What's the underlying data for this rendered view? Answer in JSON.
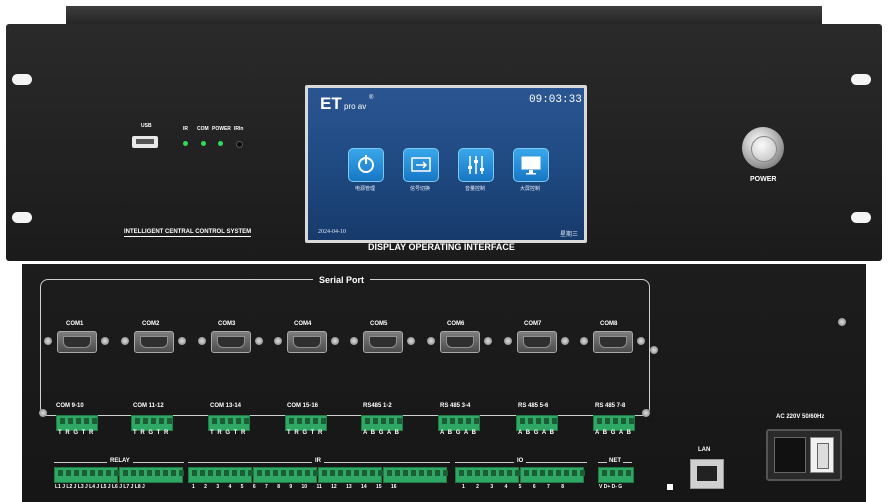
{
  "front": {
    "usb_label": "USB",
    "leds": [
      {
        "label": "IR",
        "color": "#2fdc5a"
      },
      {
        "label": "COM",
        "color": "#2fdc5a"
      },
      {
        "label": "POWER",
        "color": "#2fdc5a"
      },
      {
        "label": "IRIn",
        "color": "#1a1a1a"
      }
    ],
    "system_label": "INTELLIGENT CENTRAL CONTROL SYSTEM",
    "display_label": "DISPLAY OPERATING INTERFACE",
    "power_label": "POWER",
    "screen": {
      "brand": "ET",
      "brand_sub": "pro av",
      "registered": "®",
      "time": "09:03:33",
      "date": "2024-04-10",
      "weekday": "星期三",
      "apps": [
        {
          "label": "电源管理",
          "icon": "power-icon"
        },
        {
          "label": "信号切换",
          "icon": "switch-icon"
        },
        {
          "label": "音量控制",
          "icon": "mixer-icon"
        },
        {
          "label": "大屏控制",
          "icon": "monitor-icon"
        }
      ]
    }
  },
  "back": {
    "serial_port_label": "Serial  Port",
    "com_ports": [
      "COM1",
      "COM2",
      "COM3",
      "COM4",
      "COM5",
      "COM6",
      "COM7",
      "COM8"
    ],
    "terminal_groups": [
      {
        "label": "COM 9-10",
        "pins": "T R G T R"
      },
      {
        "label": "COM 11-12",
        "pins": "T R G T R"
      },
      {
        "label": "COM 13-14",
        "pins": "T R G T R"
      },
      {
        "label": "COM 15-16",
        "pins": "T R G T R"
      },
      {
        "label": "RS485  1-2",
        "pins": "A B G A B"
      },
      {
        "label": "RS 485 3-4",
        "pins": "A B G A B"
      },
      {
        "label": "RS 485 5-6",
        "pins": "A B G A B"
      },
      {
        "label": "RS 485 7-8",
        "pins": "A B G A B"
      }
    ],
    "bottom_groups": {
      "relay": {
        "label": "RELAY",
        "pins": "L1 J L2 J L3 J L4 J L5 J L6 J L7 J L8 J"
      },
      "ir": {
        "label": "IR",
        "pins": "1 2 3 4 5 6 7 8 9 10 11 12 13 14 15 16"
      },
      "io": {
        "label": "IO",
        "pins": "1 2 3 4 5 6 7 8"
      },
      "net": {
        "label": "NET",
        "pins": "V D+ D- G"
      }
    },
    "lan_label": "LAN",
    "ac_label": "AC 220V  50/60Hz"
  }
}
